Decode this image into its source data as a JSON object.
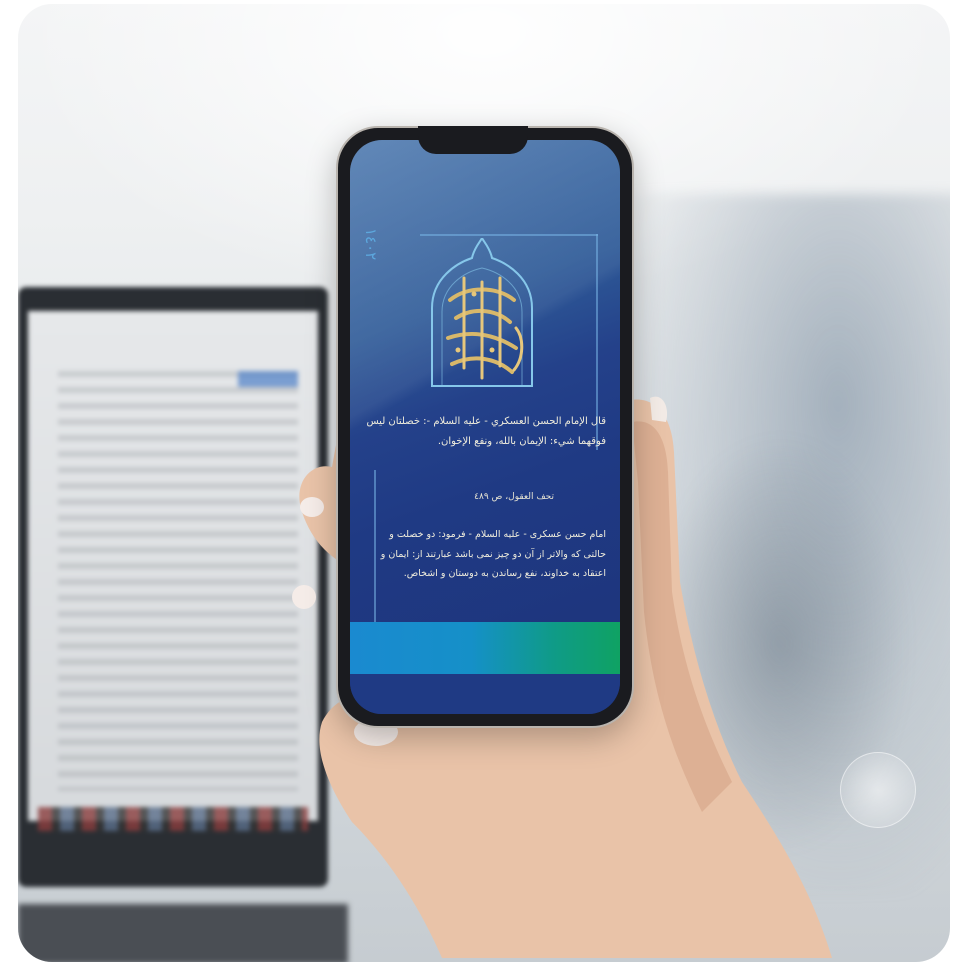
{
  "scene": {
    "background": "blurred window and city skyline",
    "device": "smartphone held in hand"
  },
  "phone_screen": {
    "side_text": "١٤٠٢",
    "quote_arabic": "قال الإمام الحسن العسكري - عليه السلام -: خصلتان ليس فوقهما شيء: الإيمان بالله، ونفع الإخوان.",
    "source": "تحف العقول، ص ٤٨٩",
    "translation_persian": "امام حسن عسكری - عليه السلام - فرمود: دو خصلت و حالتی كه والاتر از آن دو چيز نمی باشد عبارتند از: ايمان و اعتقاد به خداوند، نفع رساندن به دوستان و اشخاص.",
    "colors": {
      "screen_blue": "#1f3a84",
      "gold": "#d8b86a",
      "band_blue": "#1a8ad0",
      "band_green": "#0fa263"
    }
  }
}
